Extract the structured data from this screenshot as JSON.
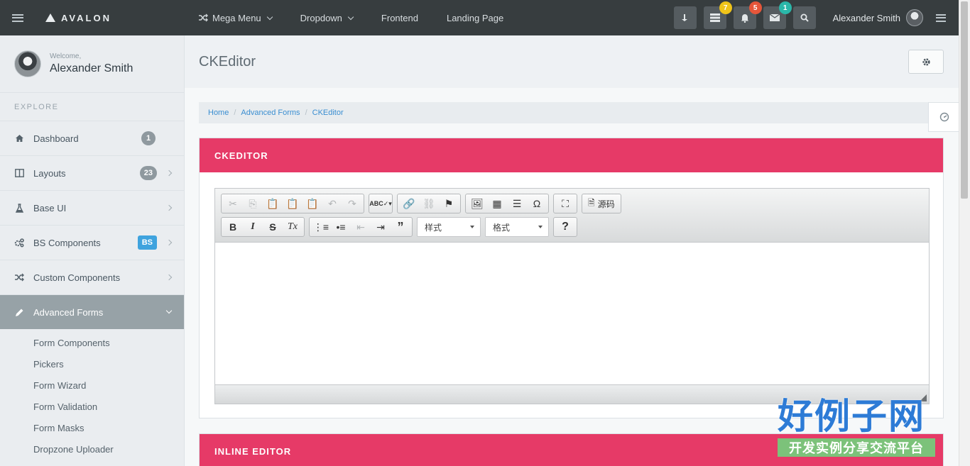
{
  "topbar": {
    "brand": "AVALON",
    "nav": [
      {
        "label": "Mega Menu",
        "has_icon": true,
        "dropdown": true
      },
      {
        "label": "Dropdown",
        "dropdown": true
      },
      {
        "label": "Frontend"
      },
      {
        "label": "Landing Page"
      }
    ],
    "badges": {
      "tasks": "7",
      "notifications": "5",
      "messages": "1"
    },
    "badge_colors": {
      "tasks": "#f0c419",
      "notifications": "#e6563a",
      "messages": "#2ab7a9"
    },
    "user_name": "Alexander Smith"
  },
  "sidebar": {
    "welcome_small": "Welcome,",
    "welcome_name": "Alexander Smith",
    "section": "EXPLORE",
    "items": [
      {
        "label": "Dashboard",
        "icon": "home-icon",
        "count": "1"
      },
      {
        "label": "Layouts",
        "icon": "columns-icon",
        "count": "23"
      },
      {
        "label": "Base UI",
        "icon": "flask-icon"
      },
      {
        "label": "BS Components",
        "icon": "cogs-icon",
        "count": "BS"
      },
      {
        "label": "Custom Components",
        "icon": "shuffle-icon"
      },
      {
        "label": "Advanced Forms",
        "icon": "pencil-icon",
        "active": true
      }
    ],
    "submenu": [
      "Form Components",
      "Pickers",
      "Form Wizard",
      "Form Validation",
      "Form Masks",
      "Dropzone Uploader"
    ]
  },
  "page": {
    "title": "CKEditor",
    "breadcrumb": [
      "Home",
      "Advanced Forms",
      "CKEditor"
    ],
    "card1_title": "CKEDITOR",
    "card2_title": "INLINE EDITOR",
    "editor": {
      "source_label": "源码",
      "styles_combo": "样式",
      "format_combo": "格式"
    }
  },
  "watermark": {
    "title": "好例子网",
    "subtitle": "开发实例分享交流平台"
  },
  "colors": {
    "topbar": "#373d3f",
    "accent": "#e63a67",
    "link": "#3a8ed1"
  }
}
